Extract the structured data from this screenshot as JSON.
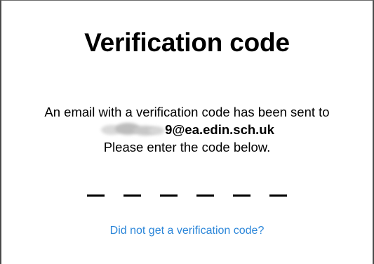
{
  "dialog": {
    "title": "Verification code",
    "message_line1": "An email with a verification code has been sent to",
    "email_visible_part": "9@ea.edin.sch.uk",
    "message_line3": "Please enter the code below."
  },
  "code_input": {
    "slots": [
      "",
      "",
      "",
      "",
      "",
      ""
    ]
  },
  "resend_link": {
    "label": "Did not get a verification code?"
  },
  "colors": {
    "link": "#2b86d9",
    "text": "#000000",
    "border": "#4a4a4a"
  }
}
